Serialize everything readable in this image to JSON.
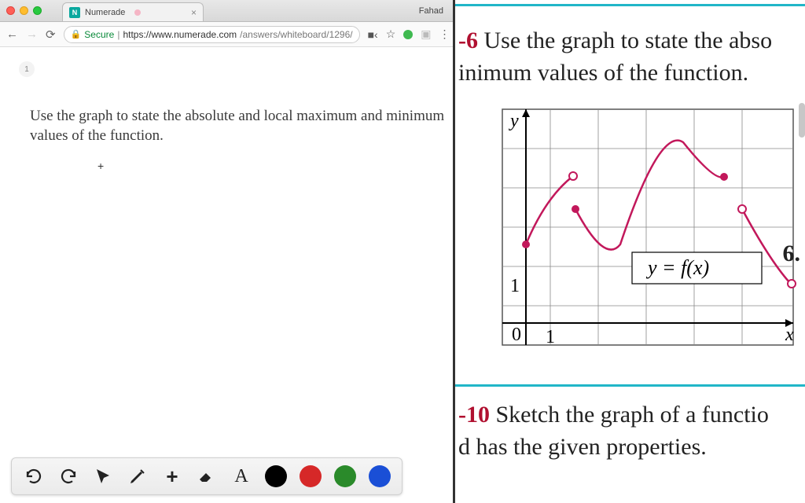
{
  "browser": {
    "tab_title": "Numerade",
    "profile": "Fahad",
    "secure_label": "Secure",
    "url_host": "https://www.numerade.com",
    "url_path": "/answers/whiteboard/1296/"
  },
  "page": {
    "marker": "1",
    "prompt": "Use the graph to state the absolute and local maximum and minimum values of the function."
  },
  "toolbar": {
    "undo": "↺",
    "redo": "↻",
    "pointer": "pointer",
    "pencil": "pencil",
    "add": "+",
    "eraser": "eraser",
    "text": "A",
    "colors": {
      "black": "#000000",
      "red": "#d62828",
      "green": "#2a8a2a",
      "blue": "#1a4fd6"
    }
  },
  "textbook": {
    "sec1_num": "-6",
    "sec1_line1": " Use the graph to state the absolute and local maximum and minimum values of the function.",
    "eqn_label": "y = f(x)",
    "axis_y": "y",
    "axis_x": "x",
    "tick0": "0",
    "tick1": "1",
    "exnum": "6.",
    "sec2_num": "-10",
    "sec2_line": " Sketch the graph of a function and has the given properties."
  },
  "chart_data": {
    "type": "line",
    "title": "y = f(x)",
    "xlabel": "x",
    "ylabel": "y",
    "xlim": [
      0,
      8
    ],
    "ylim": [
      0,
      6
    ],
    "grid": true,
    "series": [
      {
        "name": "f(x)",
        "points": [
          {
            "x": 0,
            "y": 2,
            "endpoint": "closed"
          },
          {
            "x": 1,
            "y": 4,
            "endpoint": "open"
          },
          {
            "x": 1,
            "y": 3,
            "endpoint": "closed"
          },
          {
            "x": 2,
            "y": 2
          },
          {
            "x": 3,
            "y": 4.6
          },
          {
            "x": 4,
            "y": 4
          },
          {
            "x": 5,
            "y": 4,
            "endpoint": "closed"
          },
          {
            "x": 5,
            "y": 3,
            "endpoint": "open"
          },
          {
            "x": 6,
            "y": 1,
            "endpoint": "open"
          }
        ]
      }
    ],
    "annotations": [
      {
        "text": "y = f(x)",
        "x": 4,
        "y": 1.5
      }
    ]
  }
}
